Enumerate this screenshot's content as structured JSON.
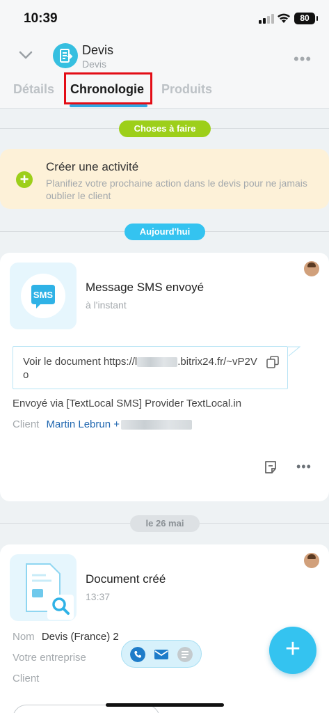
{
  "status": {
    "time": "10:39",
    "battery": "80"
  },
  "header": {
    "title": "Devis",
    "subtitle": "Devis",
    "tabs": [
      {
        "label": "Détails"
      },
      {
        "label": "Chronologie"
      },
      {
        "label": "Produits"
      }
    ]
  },
  "timeline": {
    "todo_pill": "Choses à faire",
    "activity": {
      "title": "Créer une activité",
      "description": "Planifiez votre prochaine action dans le devis pour ne jamais oublier le client"
    },
    "today_pill": "Aujourd'hui",
    "sms_card": {
      "icon_label": "SMS",
      "title": "Message SMS envoyé",
      "time": "à l'instant",
      "message_prefix": "Voir le document https://l",
      "message_suffix": ".bitrix24.fr/~vP2Vo",
      "sent_via": "Envoyé via [TextLocal SMS] Provider TextLocal.in",
      "client_label": "Client",
      "client_name": "Martin Lebrun +"
    },
    "date_pill": "le 26 mai",
    "doc_card": {
      "title": "Document créé",
      "time": "13:37",
      "name_label": "Nom",
      "name_value": "Devis (France) 2",
      "company_label": "Votre entreprise",
      "client_label": "Client"
    }
  },
  "colors": {
    "accent": "#2fa9e4",
    "green": "#9dcf1a",
    "fab": "#34c3f0",
    "highlight": "#e30d16"
  }
}
